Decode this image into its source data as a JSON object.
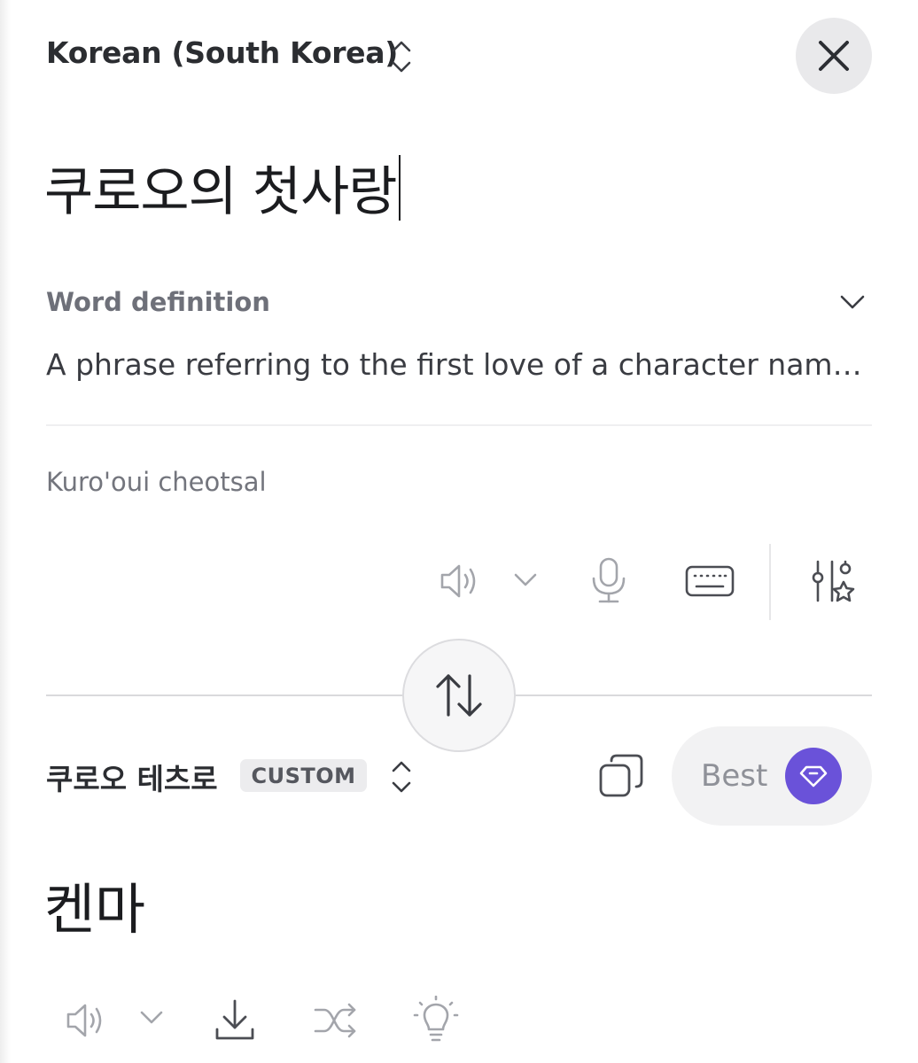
{
  "source": {
    "language": "Korean (South Korea)",
    "text": "쿠로오의 첫사랑",
    "definition_label": "Word definition",
    "definition_text": "A phrase referring to the first love of a character named Kuroo",
    "transliteration": "Kuro'oui cheotsal"
  },
  "target": {
    "language": "쿠로오 테츠로",
    "badge": "CUSTOM",
    "best_label": "Best",
    "text": "켄마"
  },
  "colors": {
    "accent": "#6a52d9",
    "icon_gray": "#9a9ca3",
    "icon_dark": "#4b4d53"
  },
  "icons": {
    "close": "close-icon",
    "swap": "swap-arrows-icon",
    "speaker": "speaker-icon",
    "mic": "microphone-icon",
    "keyboard": "keyboard-icon",
    "tune": "settings-sliders-star-icon",
    "copy": "copy-icon",
    "gem": "diamond-icon",
    "download": "download-icon",
    "shuffle": "shuffle-icon",
    "bulb": "lightbulb-icon"
  }
}
